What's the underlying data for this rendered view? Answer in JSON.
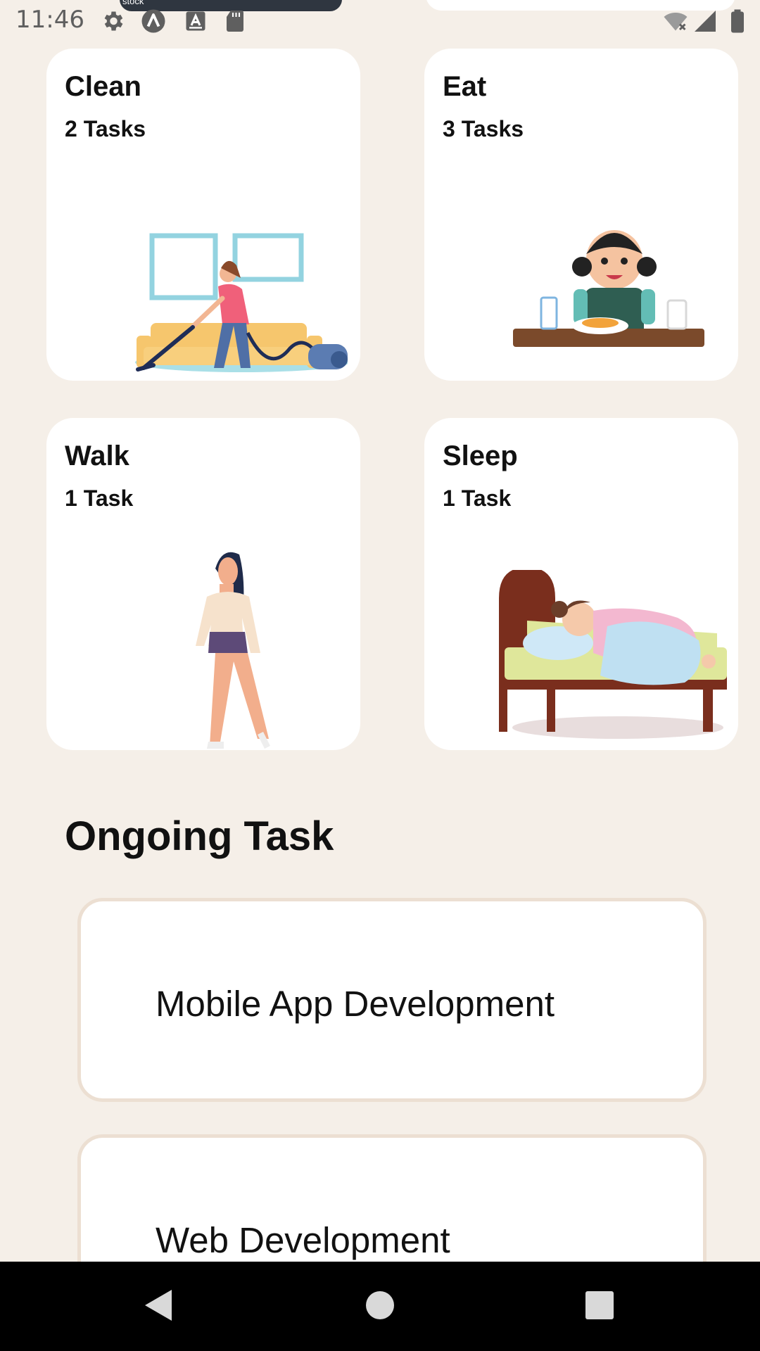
{
  "status_bar": {
    "time": "11:46",
    "left_icons": [
      "gear-icon",
      "maps-icon",
      "text-a-icon",
      "sd-card-icon"
    ],
    "right_icons": [
      "wifi-off-icon",
      "signal-icon",
      "battery-icon"
    ],
    "notification_label": "stock"
  },
  "categories": [
    {
      "title": "Clean",
      "count": "2 Tasks",
      "illustration": "cleaning-illustration"
    },
    {
      "title": "Eat",
      "count": "3 Tasks",
      "illustration": "eating-illustration"
    },
    {
      "title": "Walk",
      "count": "1 Task",
      "illustration": "walking-illustration"
    },
    {
      "title": "Sleep",
      "count": "1 Task",
      "illustration": "sleeping-illustration"
    }
  ],
  "ongoing": {
    "title": "Ongoing Task",
    "tasks": [
      {
        "label": "Mobile App Development"
      },
      {
        "label": "Web Development"
      }
    ]
  },
  "nav_bar": {
    "buttons": [
      "back-icon",
      "home-icon",
      "recents-icon"
    ]
  },
  "colors": {
    "background": "#f5efe8",
    "card": "#ffffff",
    "task_border": "#ecdfd2",
    "nav": "#000000"
  }
}
